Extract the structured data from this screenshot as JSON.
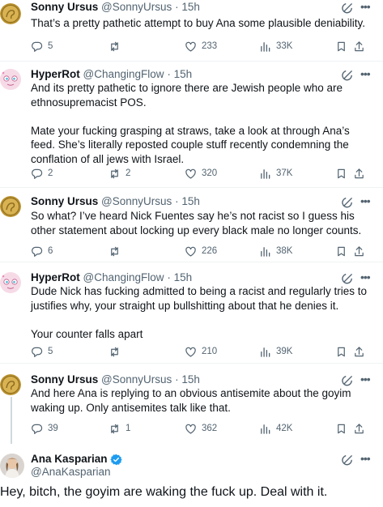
{
  "replies": [
    {
      "name": "Sonny Ursus",
      "handle": "@SonnyUrsus",
      "dot": "·",
      "time": "15h",
      "avatar": "gold-coin-avatar",
      "paragraphs": [
        "That’s a pretty pathetic attempt to buy Ana some plausible deniability."
      ],
      "stats": {
        "replies": "5",
        "retweets": "",
        "likes": "233",
        "views": "33K"
      }
    },
    {
      "name": "HyperRot",
      "handle": "@ChangingFlow",
      "dot": "·",
      "time": "15h",
      "avatar": "pink-cartoon-avatar",
      "paragraphs": [
        "And its pretty pathetic to ignore there are Jewish people who are ethnosupremacist POS.",
        "Mate your fucking grasping at straws, take a look at through Ana’s feed. She’s literally reposted couple stuff recently condemning the conflation of all jews with Israel."
      ],
      "stats": {
        "replies": "2",
        "retweets": "2",
        "likes": "320",
        "views": "37K"
      }
    },
    {
      "name": "Sonny Ursus",
      "handle": "@SonnyUrsus",
      "dot": "·",
      "time": "15h",
      "avatar": "gold-coin-avatar",
      "paragraphs": [
        "So what?  I’ve heard Nick Fuentes say he’s not racist so I guess his other statement about locking up every black male no longer counts."
      ],
      "stats": {
        "replies": "6",
        "retweets": "",
        "likes": "226",
        "views": "38K"
      }
    },
    {
      "name": "HyperRot",
      "handle": "@ChangingFlow",
      "dot": "·",
      "time": "15h",
      "avatar": "pink-cartoon-avatar",
      "paragraphs": [
        "Dude Nick has fucking admitted to being a racist and regularly tries to justifies why, your straight up bullshitting about that he denies it.",
        "Your counter falls apart"
      ],
      "stats": {
        "replies": "5",
        "retweets": "",
        "likes": "210",
        "views": "39K"
      }
    },
    {
      "name": "Sonny Ursus",
      "handle": "@SonnyUrsus",
      "dot": "·",
      "time": "15h",
      "avatar": "gold-coin-avatar",
      "paragraphs": [
        "And here Ana is replying to an obvious antisemite about the goyim waking up. Only antisemites talk like that."
      ],
      "stats": {
        "replies": "39",
        "retweets": "1",
        "likes": "362",
        "views": "42K"
      }
    }
  ],
  "main_tweet": {
    "name": "Ana Kasparian",
    "handle": "@AnaKasparian",
    "verified": true,
    "avatar": "photo-avatar",
    "text": "Hey, bitch, the goyim are waking the fuck up. Deal with it."
  },
  "icons": {
    "more": "more-icon",
    "grok": "grok-icon",
    "reply": "reply-icon",
    "retweet": "retweet-icon",
    "like": "heart-icon",
    "views": "views-icon",
    "bookmark": "bookmark-icon",
    "share": "share-icon"
  },
  "colors": {
    "text": "#0f1419",
    "secondary": "#536471",
    "divider": "#eff3f4",
    "thread_line": "#cfd9de",
    "verified": "#1d9bf0"
  }
}
